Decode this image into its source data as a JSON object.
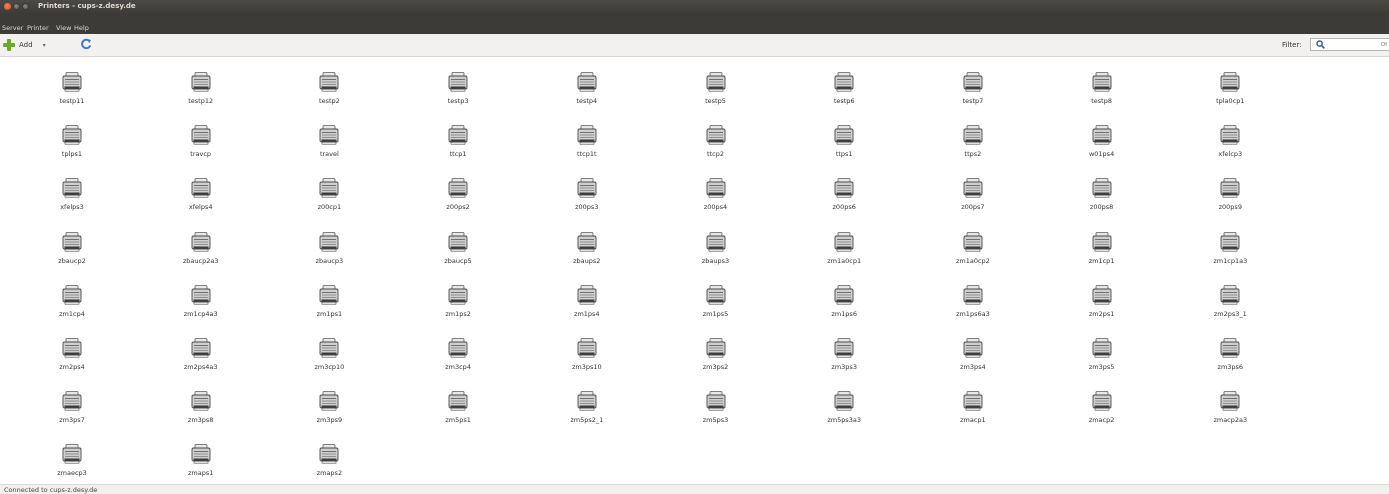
{
  "window": {
    "title": "Printers - cups-z.desy.de"
  },
  "menu": {
    "items": [
      "Server",
      "Printer",
      "View",
      "Help"
    ]
  },
  "toolbar": {
    "add_label": "Add",
    "filter_label": "Filter:",
    "filter_placeholder": "Of"
  },
  "printers": [
    "testp11",
    "testp12",
    "testp2",
    "testp3",
    "testp4",
    "testp5",
    "testp6",
    "testp7",
    "testp8",
    "tpla0cp1",
    "tplps1",
    "travcp",
    "travel",
    "ttcp1",
    "ttcp1t",
    "ttcp2",
    "ttps1",
    "ttps2",
    "w01ps4",
    "xfelcp3",
    "xfelps3",
    "xfelps4",
    "z00cp1",
    "z00ps2",
    "z00ps3",
    "z00ps4",
    "z00ps6",
    "z00ps7",
    "z00ps8",
    "z00ps9",
    "zbaucp2",
    "zbaucp2a3",
    "zbaucp3",
    "zbaucp5",
    "zbaups2",
    "zbaups3",
    "zm1a0cp1",
    "zm1a0cp2",
    "zm1cp1",
    "zm1cp1a3",
    "zm1cp4",
    "zm1cp4a3",
    "zm1ps1",
    "zm1ps2",
    "zm1ps4",
    "zm1ps5",
    "zm1ps6",
    "zm1ps6a3",
    "zm2ps1",
    "zm2ps3_1",
    "zm2ps4",
    "zm2ps4a3",
    "zm3cp10",
    "zm3cp4",
    "zm3ps10",
    "zm3ps2",
    "zm3ps3",
    "zm3ps4",
    "zm3ps5",
    "zm3ps6",
    "zm3ps7",
    "zm3ps8",
    "zm3ps9",
    "zm5ps1",
    "zm5ps2_1",
    "zm5ps3",
    "zm5ps3a3",
    "zmacp1",
    "zmacp2",
    "zmacp2a3",
    "zmaecp3",
    "zmaps1",
    "zmaps2"
  ],
  "status": {
    "text": "Connected to cups-z.desy.de"
  },
  "colors": {
    "titlebar": "#3c3b37",
    "title_text": "#dfdbd2",
    "close_button": "#e95420",
    "add_icon": "#6cab29",
    "refresh_icon": "#3a7fc3"
  }
}
